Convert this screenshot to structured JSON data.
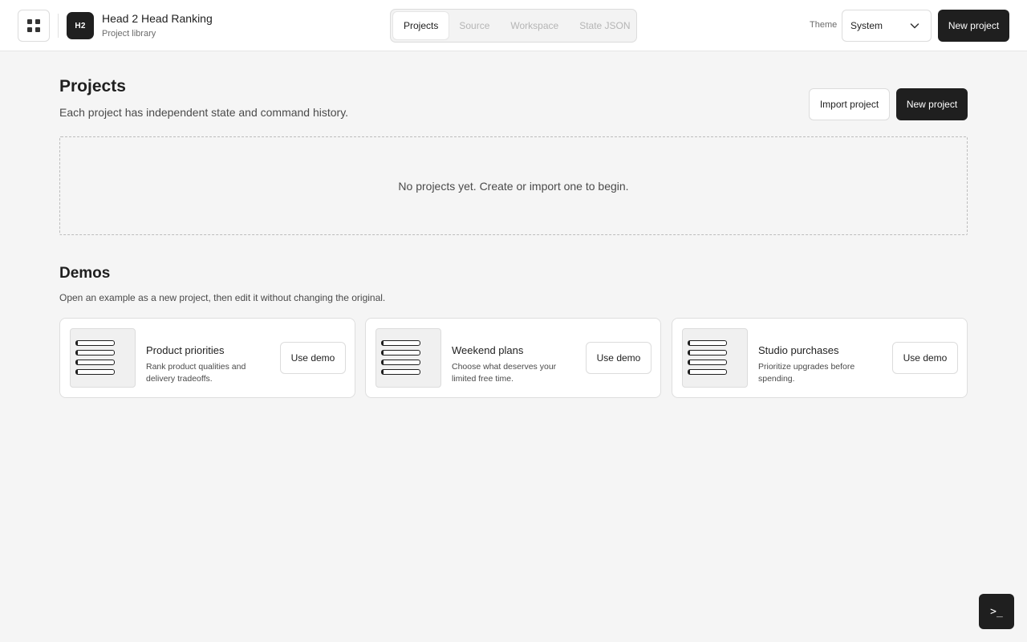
{
  "header": {
    "logo_text": "H2",
    "app_title": "Head 2 Head Ranking",
    "app_subtitle": "Project library",
    "menu_icon": "grid-icon",
    "tabs": [
      {
        "label": "Projects",
        "active": true
      },
      {
        "label": "Source",
        "active": false
      },
      {
        "label": "Workspace",
        "active": false
      },
      {
        "label": "State JSON",
        "active": false
      }
    ],
    "theme_label": "Theme",
    "theme_value": "System",
    "new_project_label": "New project"
  },
  "projects": {
    "heading": "Projects",
    "description": "Each project has independent state and command history.",
    "import_label": "Import project",
    "new_label": "New project",
    "empty_text": "No projects yet. Create or import one to begin."
  },
  "demos": {
    "heading": "Demos",
    "description": "Open an example as a new project, then edit it without changing the original.",
    "items": [
      {
        "title": "Product priorities",
        "description": "Rank product qualities and delivery tradeoffs.",
        "button": "Use demo"
      },
      {
        "title": "Weekend plans",
        "description": "Choose what deserves your limited free time.",
        "button": "Use demo"
      },
      {
        "title": "Studio purchases",
        "description": "Prioritize upgrades before spending.",
        "button": "Use demo"
      }
    ]
  },
  "terminal": {
    "label": ">_"
  },
  "colors": {
    "accent_dark": "#1f1f1f",
    "background": "#f5f5f5",
    "surface": "#ffffff",
    "border": "#dcdcdc"
  }
}
